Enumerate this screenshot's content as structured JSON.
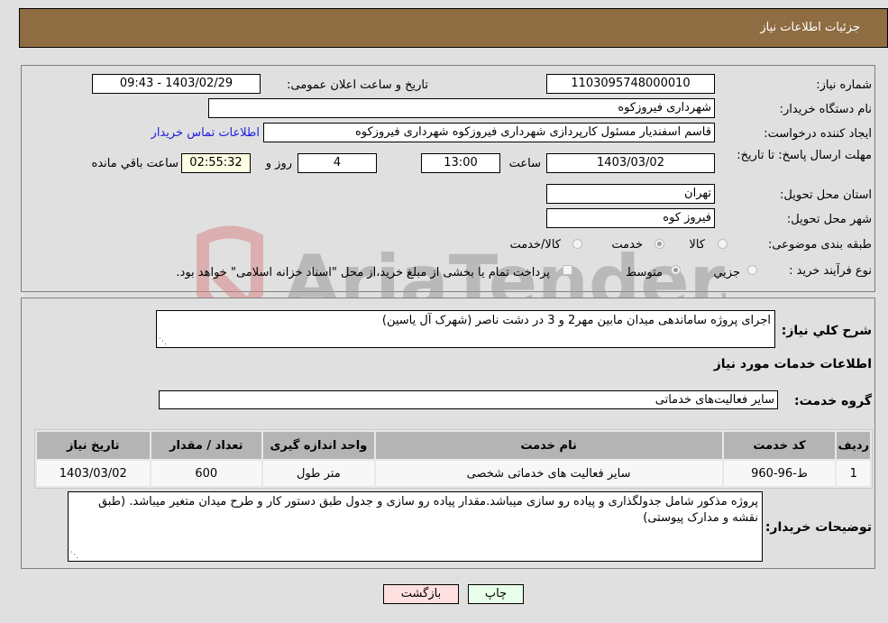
{
  "header": {
    "title": "جزئیات اطلاعات نیاز"
  },
  "fields": {
    "need_number": {
      "label": "شماره نیاز:",
      "value": "1103095748000010"
    },
    "announce": {
      "label": "تاریخ و ساعت اعلان عمومی:",
      "value": "1403/02/29 - 09:43"
    },
    "buyer_org": {
      "label": "نام دستگاه خریدار:",
      "value": "شهرداری فیروزکوه"
    },
    "requester": {
      "label": "ایجاد کننده درخواست:",
      "value": "قاسم اسفندیار مسئول کارپردازی شهرداری فیروزکوه شهرداری فیروزکوه"
    },
    "contact_link": "اطلاعات تماس خریدار",
    "deadline": {
      "label": "مهلت ارسال پاسخ: تا تاریخ:",
      "date": "1403/03/02",
      "time_label": "ساعت",
      "time": "13:00",
      "days": "4",
      "days_label": "روز و",
      "remaining": "02:55:32",
      "remaining_label": "ساعت باقي مانده"
    },
    "province": {
      "label": "استان محل تحویل:",
      "value": "تهران"
    },
    "city": {
      "label": "شهر محل تحویل:",
      "value": "فیروز کوه"
    },
    "category": {
      "label": "طبقه بندی موضوعی:",
      "options": [
        "کالا",
        "خدمت",
        "کالا/خدمت"
      ],
      "selected": "خدمت"
    },
    "process": {
      "label": "نوع فرآیند خرید :",
      "options": [
        "جزيي",
        "متوسط"
      ],
      "selected": "متوسط",
      "treasury_note": "پرداخت تمام یا بخشی از مبلغ خرید،از محل \"اسناد خزانه اسلامی\" خواهد بود.",
      "treasury_checked": false
    }
  },
  "description": {
    "label": "شرح کلي نیاز:",
    "value": "اجرای پروژه ساماندهی میدان مابین مهر2 و 3 در دشت ناصر (شهرک آل یاسین)"
  },
  "services_section": {
    "title": "اطلاعات خدمات مورد نیاز",
    "group_label": "گروه خدمت:",
    "group_value": "سایر فعالیت‌های خدماتی"
  },
  "table": {
    "headers": [
      "ردیف",
      "کد خدمت",
      "نام خدمت",
      "واحد اندازه گیری",
      "تعداد / مقدار",
      "تاریخ نیاز"
    ],
    "rows": [
      [
        "1",
        "ط-96-960",
        "سایر فعالیت های خدماتی شخصی",
        "متر طول",
        "600",
        "1403/03/02"
      ]
    ]
  },
  "buyer_notes": {
    "label": "توضیحات خریدار:",
    "value": "پروژه مذکور شامل جدولگذاری و پیاده رو سازی میباشد.مقدار پیاده رو سازی و جدول طبق دستور کار و طرح میدان متغیر میباشد. (طبق نقشه و مدارک پیوستی)"
  },
  "buttons": {
    "print": "چاپ",
    "back": "بازگشت"
  },
  "watermark": {
    "text": "AriaTender.neT"
  },
  "colors": {
    "header_bg": "#8f6d42",
    "link": "#1a1ae6",
    "print_bg": "#eaffea",
    "back_bg": "#ffe0e0",
    "remaining_bg": "#ffffe6"
  }
}
